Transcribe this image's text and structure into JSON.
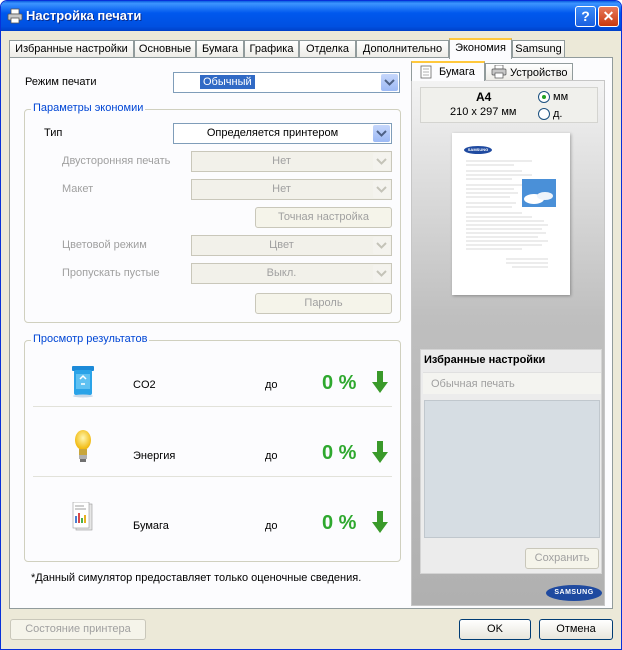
{
  "window": {
    "title": "Настройка печати"
  },
  "tabs": [
    "Избранные настройки",
    "Основные",
    "Бумага",
    "Графика",
    "Отделка",
    "Дополнительно",
    "Экономия",
    "Samsung"
  ],
  "print_mode": {
    "label": "Режим печати",
    "value": "Обычный"
  },
  "economy_group": {
    "title": "Параметры экономии",
    "type_label": "Тип",
    "type_value": "Определяется принтером",
    "duplex_label": "Двусторонняя печать",
    "duplex_value": "Нет",
    "layout_label": "Макет",
    "layout_value": "Нет",
    "fine_tune_button": "Точная настройка",
    "color_mode_label": "Цветовой режим",
    "color_mode_value": "Цвет",
    "skip_blank_label": "Пропускать пустые",
    "skip_blank_value": "Выкл.",
    "password_button": "Пароль"
  },
  "results_group": {
    "title": "Просмотр результатов",
    "rows": [
      {
        "icon": "recycle-bin-icon",
        "name": "CO2",
        "to": "до",
        "value": "0 %"
      },
      {
        "icon": "lightbulb-icon",
        "name": "Энергия",
        "to": "до",
        "value": "0 %"
      },
      {
        "icon": "paper-report-icon",
        "name": "Бумага",
        "to": "до",
        "value": "0 %"
      }
    ]
  },
  "disclaimer": "*Данный симулятор предоставляет только оценочные сведения.",
  "right": {
    "tabs": [
      "Бумага",
      "Устройство"
    ],
    "paper_size": "A4",
    "paper_dims": "210 x 297 мм",
    "unit_mm": "мм",
    "unit_inch": "д.",
    "preview_brand": "SAMSUNG",
    "fav_title": "Избранные настройки",
    "fav_placeholder": "Обычная печать",
    "save_button": "Сохранить",
    "brand_logo": "SAMSUNG"
  },
  "footer": {
    "printer_status": "Состояние принтера",
    "ok": "OK",
    "cancel": "Отмена"
  },
  "colors": {
    "accent": "#0046d5",
    "percent": "#2ea82e",
    "title_bar": "#0058ee"
  }
}
